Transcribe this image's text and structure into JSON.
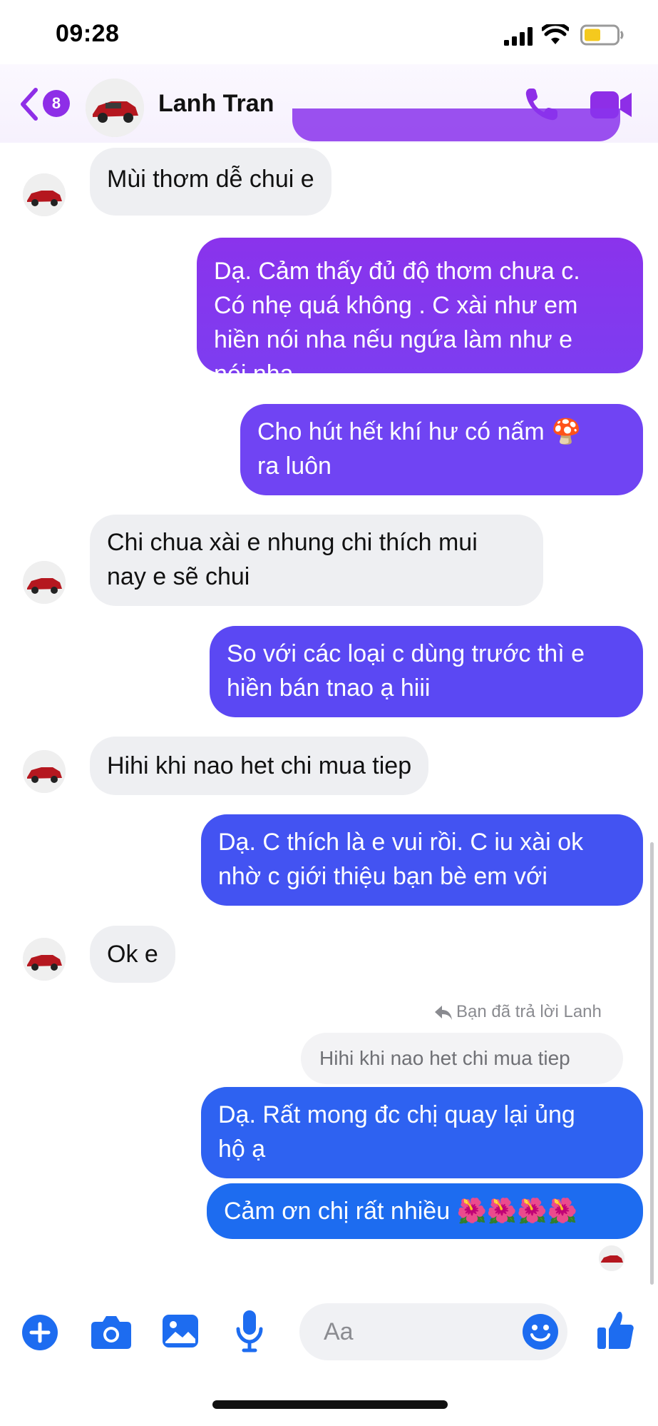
{
  "status_bar": {
    "time": "09:28"
  },
  "header": {
    "unread_count": "8",
    "contact_name": "Lanh Tran"
  },
  "messages": [
    {
      "text": "Mùi thơm dễ chui e"
    },
    {
      "text": "Dạ. Cảm thấy đủ độ thơm chưa c.\nCó nhẹ quá không . C xài như em\nhiền nói nha nếu ngứa làm như e\nnói nha"
    },
    {
      "text": "Cho hút hết khí hư có nấm 🍄\nra luôn"
    },
    {
      "text": "Chi chua xài e nhung chi thích mui\nnay e sẽ chui"
    },
    {
      "text": "So với các loại c dùng trước thì e\nhiền bán tnao ạ hiii"
    },
    {
      "text": "Hihi khi nao het chi mua tiep"
    },
    {
      "text": "Dạ. C thích là e vui rồi. C iu xài ok\nnhờ c giới thiệu bạn bè em với"
    },
    {
      "text": "Ok e"
    },
    {
      "text": "Dạ. Rất mong đc chị quay lại ủng\nhộ ạ"
    },
    {
      "text": "Cảm ơn chị rất nhiều 🌺🌺🌺🌺"
    }
  ],
  "reply": {
    "note": "Bạn đã trả lời Lanh",
    "quoted": "Hihi khi nao het chi mua tiep"
  },
  "composer": {
    "placeholder": "Aa"
  },
  "colors": {
    "accent": "#8e2ee7",
    "bubble_purple": "#7b3ff2",
    "bubble_blue": "#1d6cf0",
    "incoming": "#eeeff2"
  },
  "icons": [
    "back-chevron-icon",
    "phone-icon",
    "video-camera-icon",
    "plus-icon",
    "camera-icon",
    "gallery-icon",
    "microphone-icon",
    "emoji-icon",
    "thumbs-up-icon",
    "reply-arrow-icon"
  ]
}
